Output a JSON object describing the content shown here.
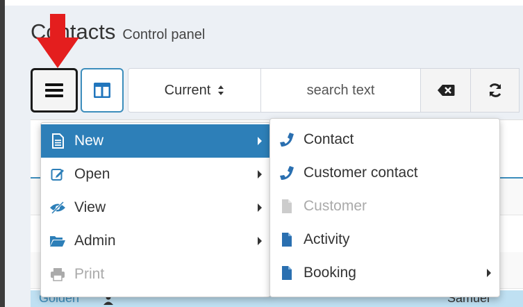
{
  "title": {
    "main": "Contacts",
    "sub": "Control panel"
  },
  "toolbar": {
    "status_select": "Current",
    "search_placeholder": "search text"
  },
  "table": {
    "visible_row_left": "Golden",
    "visible_row_right": "Samuel"
  },
  "main_menu": {
    "items": [
      {
        "label": "New",
        "icon": "file-text-icon",
        "active": true,
        "has_submenu": true
      },
      {
        "label": "Open",
        "icon": "edit-icon",
        "has_submenu": true
      },
      {
        "label": "View",
        "icon": "eye-slash-icon",
        "has_submenu": true
      },
      {
        "label": "Admin",
        "icon": "folder-open-icon",
        "has_submenu": true
      },
      {
        "label": "Print",
        "icon": "print-icon",
        "disabled": true
      }
    ]
  },
  "sub_menu": {
    "items": [
      {
        "label": "Contact",
        "icon": "phone-icon"
      },
      {
        "label": "Customer contact",
        "icon": "phone-icon"
      },
      {
        "label": "Customer",
        "icon": "file-icon",
        "disabled": true
      },
      {
        "label": "Activity",
        "icon": "file-icon"
      },
      {
        "label": "Booking",
        "icon": "file-icon",
        "has_submenu": true
      }
    ]
  },
  "colors": {
    "accent": "#2d7fb8",
    "phone_icon": "#2a6fb0",
    "arrow": "#e41e1e"
  }
}
